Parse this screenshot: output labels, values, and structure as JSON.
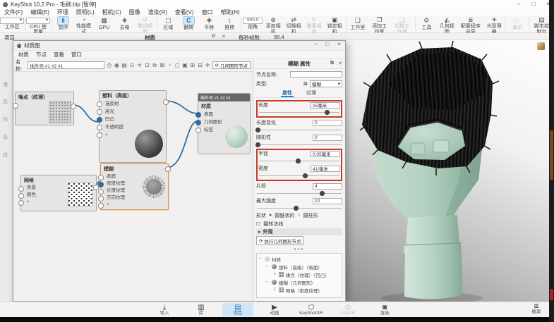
{
  "titlebar": {
    "title": "KeyShot 10.2 Pro - 毛刷.bip [暂停]",
    "minimize": "–",
    "maximize": "□",
    "close": "×"
  },
  "glyphs": {
    "chevron_down": "▾",
    "restore": "⧉",
    "close": "✕",
    "refresh": "⟳",
    "radio_on": "●",
    "radio_off": "○",
    "checkbox": "☐",
    "arrow_right": "▸",
    "trash": "⊠",
    "arrow_left": "◂",
    "arrow_rt": "▸"
  },
  "menubar": {
    "items": [
      "文件(F)",
      "编辑(E)",
      "环境",
      "照明(L)",
      "相机(C)",
      "图像",
      "渲染(R)",
      "查看(V)",
      "窗口",
      "帮助(H)"
    ]
  },
  "ribbon": {
    "items": [
      {
        "label": "工作区"
      },
      {
        "label": "CPU 使用量"
      },
      {
        "label": "暂停",
        "icon": "‖"
      },
      {
        "label": "性能模式",
        "icon": "◔"
      },
      {
        "label": "GPU",
        "icon": "▦"
      },
      {
        "label": "去噪",
        "icon": "❖"
      },
      {
        "label": "重设视图",
        "icon": "↺"
      },
      {
        "label": "区域",
        "icon": "▢"
      },
      {
        "label": "翻转",
        "icon": "C"
      },
      {
        "label": "平移",
        "icon": "✚"
      },
      {
        "label": "推移",
        "icon": "↕"
      },
      {
        "label": "视角",
        "value": "900.0"
      },
      {
        "label": "添加相机",
        "icon": "⊕"
      },
      {
        "label": "切换相机",
        "icon": "⇄"
      },
      {
        "label": "重置相机",
        "icon": "↻"
      },
      {
        "label": "锁定相机",
        "icon": "▣"
      },
      {
        "label": "工作室",
        "icon": "❏"
      },
      {
        "label": "添加工作室",
        "icon": "❐"
      },
      {
        "label": "切换工作室",
        "icon": "❑"
      },
      {
        "label": "工具",
        "icon": "⚙"
      },
      {
        "label": "几何视图",
        "icon": "◭"
      },
      {
        "label": "配置程序向导",
        "icon": "≣"
      },
      {
        "label": "光管理器",
        "icon": "☀"
      },
      {
        "label": "演示",
        "icon": "▷"
      },
      {
        "label": "脚本控制台",
        "icon": "▤"
      }
    ]
  },
  "statusbar": {
    "project_tab": "项目",
    "panel_title": "材质",
    "fps_label": "每秒帧数:",
    "fps_value": "50.4"
  },
  "left_sliver": {
    "chars": [
      "漫",
      "高",
      "凹",
      "高",
      "纹"
    ]
  },
  "graph_window": {
    "title": "材质图",
    "menus": [
      "材质",
      "节点",
      "查看",
      "窗口"
    ],
    "name_label": "名称:",
    "name_value": "插外壳 #1 #2 #1",
    "geometry_node_button": "几何图形节点",
    "toolbar_icons": [
      {
        "name": "save",
        "glyph": "⎙"
      },
      {
        "name": "material-preview",
        "glyph": "◉"
      },
      {
        "name": "show-list",
        "glyph": "▤"
      },
      {
        "name": "history",
        "glyph": "⊙"
      },
      {
        "name": "align-nodes",
        "glyph": "≑"
      },
      {
        "name": "lock",
        "glyph": "⊡"
      },
      {
        "name": "duplicate",
        "glyph": "⧉"
      },
      {
        "name": "delete",
        "glyph": "⊠"
      },
      {
        "name": "thumb-small",
        "glyph": "▫"
      },
      {
        "name": "thumb-medium",
        "glyph": "◻"
      },
      {
        "name": "thumb-large",
        "glyph": "▣"
      },
      {
        "name": "zoom-in",
        "glyph": "⊞"
      },
      {
        "name": "zoom-out",
        "glyph": "⊟"
      },
      {
        "name": "center-view",
        "glyph": "✛"
      }
    ],
    "nodes": {
      "noise": {
        "title": "噪点（纹理）",
        "inputs": [
          "·"
        ]
      },
      "plastic": {
        "title": "塑料（高级）",
        "inputs": [
          "漫反射",
          "高光",
          "凹凸",
          "不透明度",
          "+"
        ]
      },
      "material": {
        "header": "插外壳 #1 #2 #1",
        "title": "材质",
        "inputs": [
          "表面",
          "几何图形",
          "标签"
        ]
      },
      "fuzz": {
        "title": "模糊",
        "inputs": [
          "表面",
          "密度纹理",
          "长度纹理",
          "方向纹理",
          "+"
        ]
      },
      "grid": {
        "title": "网格",
        "inputs": [
          "背景",
          "颜色",
          "+"
        ]
      }
    }
  },
  "panel": {
    "title": "模糊 属性",
    "node_name_label": "节点名称:",
    "type_label": "类型:",
    "type_value": "模糊",
    "tabs": [
      "属性",
      "纹理"
    ],
    "params": [
      {
        "label": "长度",
        "value": "15毫米",
        "slider": "84%"
      },
      {
        "label": "长度变化",
        "value": "0",
        "slider": "2%"
      },
      {
        "label": "随机性",
        "value": "0",
        "slider": "2%"
      },
      {
        "label": "半径",
        "value": "0.05毫米",
        "slider": "48%"
      },
      {
        "label": "密度",
        "value": "41/毫米",
        "slider": "57%"
      },
      {
        "label": "片段",
        "value": "4",
        "slider": "76%"
      },
      {
        "label": "最大翘度",
        "value": "10",
        "slider": "46%"
      }
    ],
    "shape_label": "形状",
    "shape_options": [
      "圆锥状的",
      "圆柱形"
    ],
    "flip_normals": "翻转法线",
    "section": "外观",
    "execute_button": "执行几何图形节点",
    "splitter": "•••",
    "tree": [
      {
        "toggle": "−",
        "label": "材质"
      },
      {
        "toggle": "−",
        "label": "塑料（高级）（表面）"
      },
      {
        "toggle": "└",
        "label": "噪点（纹理）（凹凸）"
      },
      {
        "toggle": "−",
        "label": "模糊（几何图形）"
      },
      {
        "toggle": "└",
        "label": "网格（密度纹理）"
      }
    ]
  },
  "dock": {
    "items": [
      {
        "label": "导入",
        "icon": "⤓"
      },
      {
        "label": "库",
        "icon": "▥"
      },
      {
        "label": "项目",
        "icon": "▤"
      },
      {
        "label": "动画",
        "icon": "▶"
      },
      {
        "label": "KeyShotXR",
        "icon": "⬡"
      },
      {
        "label": "KeyVR",
        "icon": "◎"
      },
      {
        "label": "渲染",
        "icon": "◙"
      }
    ],
    "screenshot": {
      "label": "截屏",
      "icon": "⧈"
    }
  },
  "colors": {
    "accent_blue": "#2f7fc1",
    "annotation_red": "#c43b2b",
    "mint": "#b7d3c4",
    "wire_blue": "#2e6da4"
  }
}
